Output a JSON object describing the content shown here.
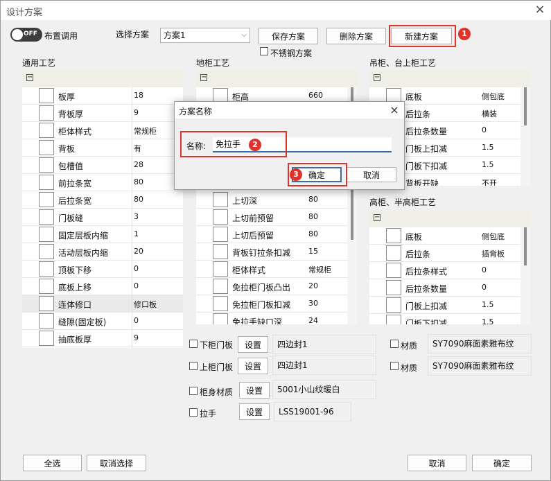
{
  "window": {
    "title": "设计方案",
    "close": "×"
  },
  "toggle": {
    "state": "OFF",
    "label": "布置调用"
  },
  "scheme": {
    "select_label": "选择方案",
    "selected": "方案1",
    "save": "保存方案",
    "delete": "删除方案",
    "new": "新建方案",
    "stainless": "不锈钢方案"
  },
  "sections": {
    "general": "通用工艺",
    "base": "地柜工艺",
    "hanging": "吊柜、台上柜工艺",
    "tall": "高柜、半高柜工艺"
  },
  "general_rows": [
    {
      "name": "板厚",
      "value": "18"
    },
    {
      "name": "背板厚",
      "value": "9"
    },
    {
      "name": "柜体样式",
      "value": "常规柜"
    },
    {
      "name": "背板",
      "value": "有"
    },
    {
      "name": "包槽值",
      "value": "28"
    },
    {
      "name": "前拉条宽",
      "value": "80"
    },
    {
      "name": "后拉条宽",
      "value": "80"
    },
    {
      "name": "门板缝",
      "value": "3"
    },
    {
      "name": "固定层板内缩",
      "value": "1"
    },
    {
      "name": "活动层板内缩",
      "value": "20"
    },
    {
      "name": "顶板下移",
      "value": "0"
    },
    {
      "name": "底板上移",
      "value": "0"
    },
    {
      "name": "连体修口",
      "value": "修口板"
    },
    {
      "name": "缝隙(固定板)",
      "value": "0"
    },
    {
      "name": "抽底板厚",
      "value": "9"
    }
  ],
  "base_rows_top": [
    {
      "name": "柜高",
      "value": "660"
    }
  ],
  "base_rows": [
    {
      "name": "上切深",
      "value": "80"
    },
    {
      "name": "上切前预留",
      "value": "80"
    },
    {
      "name": "上切后预留",
      "value": "80"
    },
    {
      "name": "背板钉拉条扣减",
      "value": "15"
    },
    {
      "name": "柜体样式",
      "value": "常规柜"
    },
    {
      "name": "免拉柜门板凸出",
      "value": "20"
    },
    {
      "name": "免拉柜门板扣减",
      "value": "30"
    },
    {
      "name": "免拉手缺口深",
      "value": "24"
    }
  ],
  "hanging_rows": [
    {
      "name": "底板",
      "value": "侧包底"
    },
    {
      "name": "后拉条",
      "value": "横装"
    },
    {
      "name": "后拉条数量",
      "value": "0"
    },
    {
      "name": "门板上扣减",
      "value": "1.5"
    },
    {
      "name": "门板下扣减",
      "value": "1.5"
    },
    {
      "name": "背板开缺",
      "value": "不开"
    }
  ],
  "tall_rows": [
    {
      "name": "底板",
      "value": "侧包底"
    },
    {
      "name": "后拉条",
      "value": "插背板"
    },
    {
      "name": "后拉条样式",
      "value": "0"
    },
    {
      "name": "后拉条数量",
      "value": "0"
    },
    {
      "name": "门板上扣减",
      "value": "1.5"
    },
    {
      "name": "门板下扣减",
      "value": "1.5"
    }
  ],
  "materials": [
    {
      "label": "下柜门板",
      "btn": "设置",
      "value": "四边封1"
    },
    {
      "label": "上柜门板",
      "btn": "设置",
      "value": "四边封1"
    },
    {
      "label": "柜身材质",
      "btn": "设置",
      "value": "5001小山纹暖白"
    },
    {
      "label": "拉手",
      "btn": "设置",
      "value": "LSS19001-96"
    }
  ],
  "right_materials": [
    {
      "label": "材质",
      "value": "SY7090麻面素雅布纹"
    },
    {
      "label": "材质",
      "value": "SY7090麻面素雅布纹"
    }
  ],
  "bottom": {
    "select_all": "全选",
    "cancel_select": "取消选择",
    "cancel": "取消",
    "ok": "确定"
  },
  "dialog": {
    "title": "方案名称",
    "close": "×",
    "name_label": "名称:",
    "name_value": "免拉手",
    "ok": "确定",
    "cancel": "取消"
  },
  "badges": [
    "1",
    "2",
    "3"
  ],
  "colors": {
    "accent_red": "#e0312b",
    "toggle_bg": "#3d3d3d",
    "field_bg": "#f0f0f0",
    "input_underline": "#3a6ea5"
  }
}
